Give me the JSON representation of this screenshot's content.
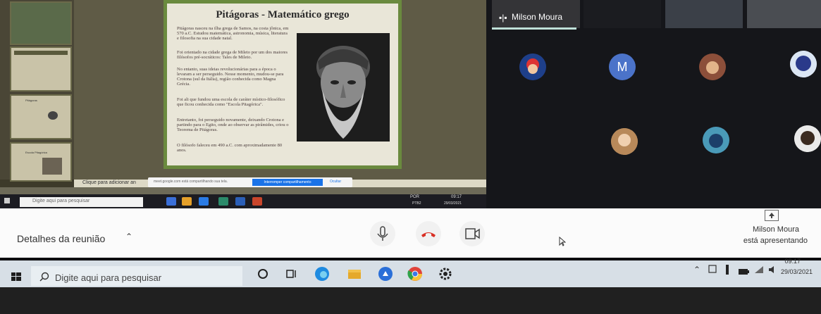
{
  "slide": {
    "title": "Pitágoras - Matemático grego",
    "paragraphs": [
      "Pitágoras nasceu na ilha grega de Samos, na costa jônica, em 570 a.C. Estudou matemática, astronomia, música, literatura e filosofia na sua cidade natal.",
      "Foi orientado na cidade grega de Mileto por um dos maiores filósofos pré-socráticos: Tales de Mileto.",
      "No entanto, suas ideias revolucionárias para a época o levaram a ser perseguido. Nesse momento, mudou-se para Crotona (sul da Itália), região conhecida como Magna Grécia.",
      "Foi ali que fundou uma escola de caráter místico-filosófico que ficou conhecida como \"Escola Pitagórica\".",
      "Entretanto, foi perseguido novamente, deixando Crotona e partindo para o Egito, onde ao observar as pirâmides, criou o Teorema de Pitágoras.",
      "O filósofo faleceu em 490 a.C. com aproximadamente 80 anos."
    ],
    "notes_placeholder": "Clique para adicionar an"
  },
  "thumbs": [
    "Pitágoras",
    "Escola Pitagórica"
  ],
  "share_bar": {
    "text": "meet.google.com está compartilhando sua tela.",
    "stop_label": "Interromper compartilhamento",
    "hide_label": "Ocultar"
  },
  "inner_taskbar": {
    "search_placeholder": "Digite aqui para pesquisar",
    "lang": "POR",
    "time": "09:17",
    "date": "29/03/2021",
    "layout": "PTB2"
  },
  "participants": {
    "speaker": "Milson Moura",
    "avatar_letter": "M"
  },
  "controls": {
    "details_label": "Detalhes da reunião",
    "presenter_name": "Milson Moura",
    "presenting_text": "está apresentando"
  },
  "taskbar": {
    "search_placeholder": "Digite aqui para pesquisar",
    "time": "09:17",
    "date": "29/03/2021"
  },
  "colors": {
    "slide_border": "#6a8a3e",
    "hangup": "#d93025",
    "share_stop": "#1a73e8",
    "avatar_m": "#4b73c9"
  }
}
